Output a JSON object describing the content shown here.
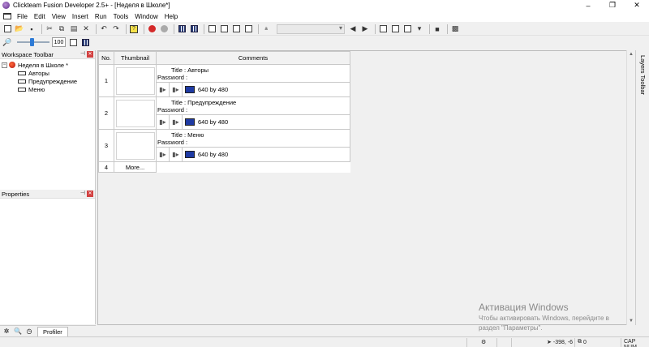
{
  "window": {
    "title": "Clickteam Fusion Developer 2.5+ - [Неделя в Школе*]",
    "controls": [
      "–",
      "❐",
      "✕"
    ]
  },
  "menu": [
    "File",
    "Edit",
    "View",
    "Insert",
    "Run",
    "Tools",
    "Window",
    "Help"
  ],
  "toolbar": {
    "zoom_value": "100",
    "zoom_level": 0.45
  },
  "workspace": {
    "title": "Workspace Toolbar",
    "root_label": "Неделя в Школе *",
    "root_expander": "−",
    "frames": [
      "Авторы",
      "Предупреждение",
      "Меню"
    ]
  },
  "properties": {
    "title": "Properties"
  },
  "bottom_tabs": {
    "profiler_label": "Profiler"
  },
  "grid": {
    "headers": {
      "no": "No.",
      "thumbnail": "Thumbnail",
      "comments": "Comments"
    },
    "rows": [
      {
        "no": "1",
        "title": "Title : Авторы",
        "password": "Password :",
        "size": "640  by 480"
      },
      {
        "no": "2",
        "title": "Title : Предупреждение",
        "password": "Password :",
        "size": "640  by 480"
      },
      {
        "no": "3",
        "title": "Title : Меню",
        "password": "Password :",
        "size": "640  by 480"
      }
    ],
    "more_row": {
      "no": "4",
      "label": "More..."
    }
  },
  "layers_toolbar": {
    "label": "Layers Toolbar"
  },
  "watermark": {
    "heading": "Активация Windows",
    "line1": "Чтобы активировать Windows, перейдите в",
    "line2": "раздел \"Параметры\"."
  },
  "status": {
    "coords": "-398, -6",
    "objects": "0",
    "caps": "CAP NUM"
  }
}
